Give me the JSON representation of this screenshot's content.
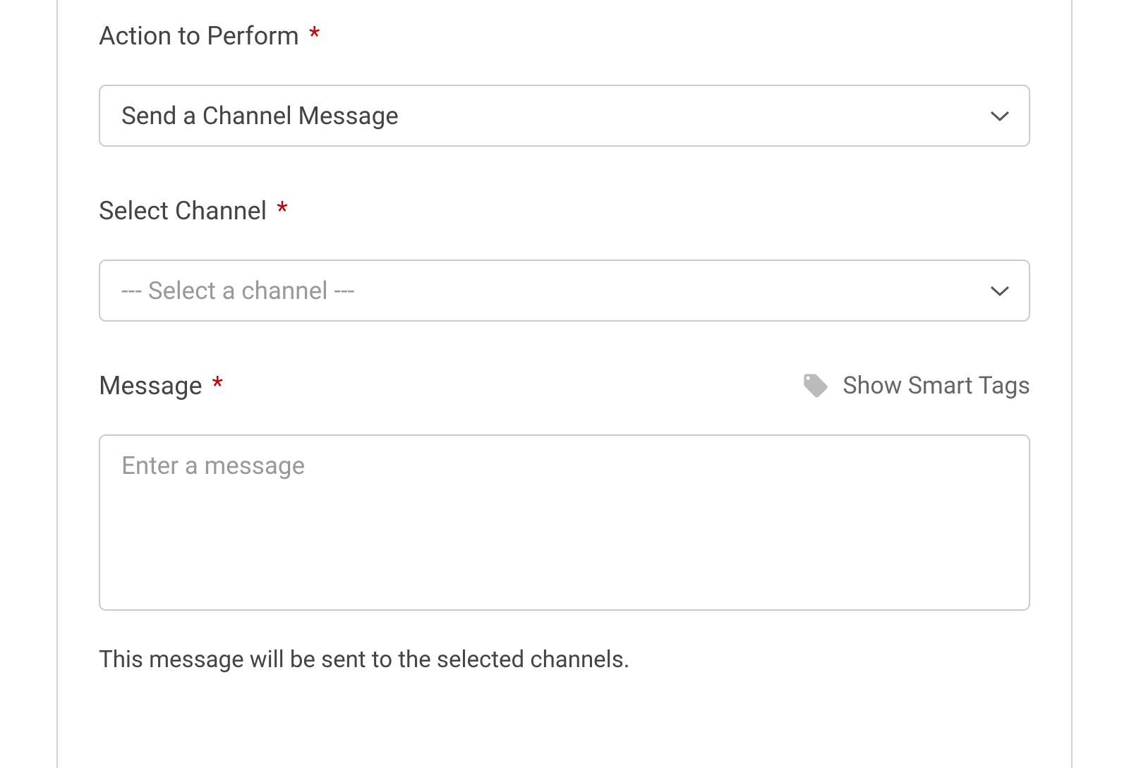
{
  "form": {
    "action": {
      "label": "Action to Perform",
      "required_marker": "*",
      "selected": "Send a Channel Message"
    },
    "channel": {
      "label": "Select Channel",
      "required_marker": "*",
      "placeholder": "--- Select a channel ---"
    },
    "message": {
      "label": "Message",
      "required_marker": "*",
      "smart_tags_label": "Show Smart Tags",
      "placeholder": "Enter a message",
      "value": "",
      "help_text": "This message will be sent to the selected channels."
    }
  }
}
